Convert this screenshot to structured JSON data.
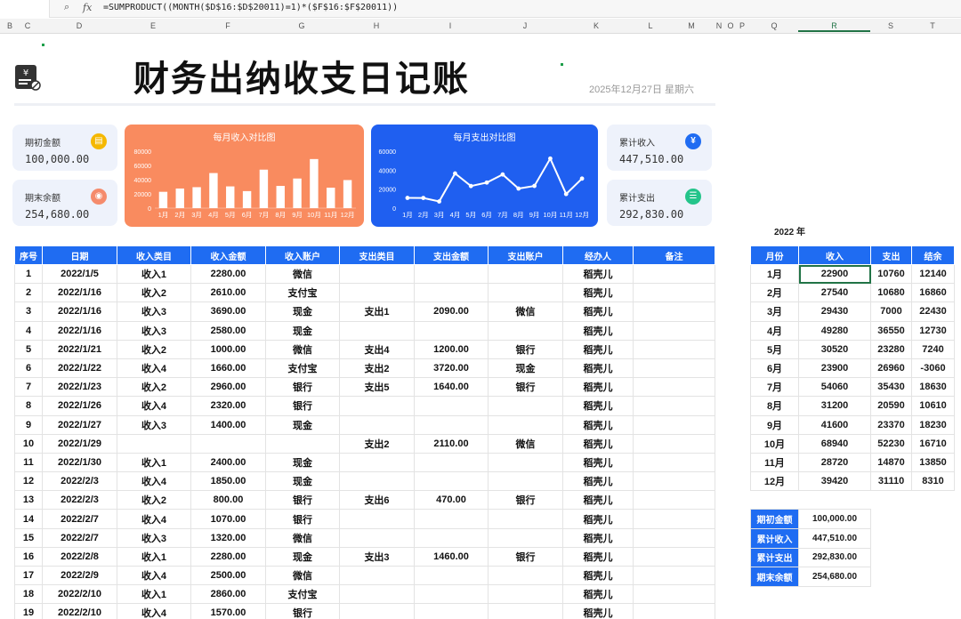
{
  "formula_bar": {
    "zoom_icon": "zoom-icon",
    "fx_label": "fx",
    "formula": "=SUMPRODUCT((MONTH($D$16:$D$20011)=1)*($F$16:$F$20011))"
  },
  "column_headers": [
    "B",
    "C",
    "D",
    "E",
    "F",
    "G",
    "H",
    "I",
    "J",
    "K",
    "L",
    "M",
    "N",
    "O",
    "P",
    "Q",
    "R",
    "S",
    "T"
  ],
  "title": "财务出纳收支日记账",
  "date": "2025年12月27日 星期六",
  "cards": {
    "opening": {
      "label": "期初金额",
      "value": "100,000.00",
      "icon": "wallet-icon",
      "color": "#f5b800"
    },
    "closing": {
      "label": "期末余额",
      "value": "254,680.00",
      "icon": "moneybag-icon",
      "color": "#f58b6c"
    },
    "total_income": {
      "label": "累计收入",
      "value": "447,510.00",
      "icon": "yen-icon",
      "color": "#1f6cf2"
    },
    "total_expense": {
      "label": "累计支出",
      "value": "292,830.00",
      "icon": "clipboard-icon",
      "color": "#24c48a"
    }
  },
  "chart_data": [
    {
      "type": "bar",
      "title": "每月收入对比图",
      "categories": [
        "1月",
        "2月",
        "3月",
        "4月",
        "5月",
        "6月",
        "7月",
        "8月",
        "9月",
        "10月",
        "11月",
        "12月"
      ],
      "values": [
        22900,
        27540,
        29430,
        49280,
        30520,
        23900,
        54060,
        31200,
        41600,
        68940,
        28720,
        39420
      ],
      "yticks": [
        "0",
        "20000",
        "40000",
        "60000",
        "80000"
      ],
      "ylim": [
        0,
        80000
      ],
      "colors": {
        "bg": "#f98b5f",
        "bar": "#ffffff",
        "text": "#ffffff"
      }
    },
    {
      "type": "line",
      "title": "每月支出对比图",
      "categories": [
        "1月",
        "2月",
        "3月",
        "4月",
        "5月",
        "6月",
        "7月",
        "8月",
        "9月",
        "10月",
        "11月",
        "12月"
      ],
      "values": [
        10760,
        10680,
        7000,
        36550,
        23280,
        26960,
        35430,
        20590,
        23370,
        52230,
        14870,
        31110
      ],
      "yticks": [
        "0",
        "20000",
        "40000",
        "60000"
      ],
      "ylim": [
        0,
        60000
      ],
      "colors": {
        "bg": "#1f5ff0",
        "line": "#ffffff",
        "text": "#ffffff"
      }
    }
  ],
  "main_table": {
    "headers": [
      "序号",
      "日期",
      "收入类目",
      "收入金额",
      "收入账户",
      "支出类目",
      "支出金额",
      "支出账户",
      "经办人",
      "备注"
    ],
    "rows": [
      [
        "1",
        "2022/1/5",
        "收入1",
        "2280.00",
        "微信",
        "",
        "",
        "",
        "稻壳儿",
        ""
      ],
      [
        "2",
        "2022/1/16",
        "收入2",
        "2610.00",
        "支付宝",
        "",
        "",
        "",
        "稻壳儿",
        ""
      ],
      [
        "3",
        "2022/1/16",
        "收入3",
        "3690.00",
        "现金",
        "支出1",
        "2090.00",
        "微信",
        "稻壳儿",
        ""
      ],
      [
        "4",
        "2022/1/16",
        "收入3",
        "2580.00",
        "现金",
        "",
        "",
        "",
        "稻壳儿",
        ""
      ],
      [
        "5",
        "2022/1/21",
        "收入2",
        "1000.00",
        "微信",
        "支出4",
        "1200.00",
        "银行",
        "稻壳儿",
        ""
      ],
      [
        "6",
        "2022/1/22",
        "收入4",
        "1660.00",
        "支付宝",
        "支出2",
        "3720.00",
        "现金",
        "稻壳儿",
        ""
      ],
      [
        "7",
        "2022/1/23",
        "收入2",
        "2960.00",
        "银行",
        "支出5",
        "1640.00",
        "银行",
        "稻壳儿",
        ""
      ],
      [
        "8",
        "2022/1/26",
        "收入4",
        "2320.00",
        "银行",
        "",
        "",
        "",
        "稻壳儿",
        ""
      ],
      [
        "9",
        "2022/1/27",
        "收入3",
        "1400.00",
        "现金",
        "",
        "",
        "",
        "稻壳儿",
        ""
      ],
      [
        "10",
        "2022/1/29",
        "",
        "",
        "",
        "支出2",
        "2110.00",
        "微信",
        "稻壳儿",
        ""
      ],
      [
        "11",
        "2022/1/30",
        "收入1",
        "2400.00",
        "现金",
        "",
        "",
        "",
        "稻壳儿",
        ""
      ],
      [
        "12",
        "2022/2/3",
        "收入4",
        "1850.00",
        "现金",
        "",
        "",
        "",
        "稻壳儿",
        ""
      ],
      [
        "13",
        "2022/2/3",
        "收入2",
        "800.00",
        "银行",
        "支出6",
        "470.00",
        "银行",
        "稻壳儿",
        ""
      ],
      [
        "14",
        "2022/2/7",
        "收入4",
        "1070.00",
        "银行",
        "",
        "",
        "",
        "稻壳儿",
        ""
      ],
      [
        "15",
        "2022/2/7",
        "收入3",
        "1320.00",
        "微信",
        "",
        "",
        "",
        "稻壳儿",
        ""
      ],
      [
        "16",
        "2022/2/8",
        "收入1",
        "2280.00",
        "现金",
        "支出3",
        "1460.00",
        "银行",
        "稻壳儿",
        ""
      ],
      [
        "17",
        "2022/2/9",
        "收入4",
        "2500.00",
        "微信",
        "",
        "",
        "",
        "稻壳儿",
        ""
      ],
      [
        "18",
        "2022/2/10",
        "收入1",
        "2860.00",
        "支付宝",
        "",
        "",
        "",
        "稻壳儿",
        ""
      ],
      [
        "19",
        "2022/2/10",
        "收入4",
        "1570.00",
        "银行",
        "",
        "",
        "",
        "稻壳儿",
        ""
      ]
    ]
  },
  "year_label": "2022 年",
  "monthly_table": {
    "headers": [
      "月份",
      "收入",
      "支出",
      "结余"
    ],
    "rows": [
      [
        "1月",
        "22900",
        "10760",
        "12140"
      ],
      [
        "2月",
        "27540",
        "10680",
        "16860"
      ],
      [
        "3月",
        "29430",
        "7000",
        "22430"
      ],
      [
        "4月",
        "49280",
        "36550",
        "12730"
      ],
      [
        "5月",
        "30520",
        "23280",
        "7240"
      ],
      [
        "6月",
        "23900",
        "26960",
        "-3060"
      ],
      [
        "7月",
        "54060",
        "35430",
        "18630"
      ],
      [
        "8月",
        "31200",
        "20590",
        "10610"
      ],
      [
        "9月",
        "41600",
        "23370",
        "18230"
      ],
      [
        "10月",
        "68940",
        "52230",
        "16710"
      ],
      [
        "11月",
        "28720",
        "14870",
        "13850"
      ],
      [
        "12月",
        "39420",
        "31110",
        "8310"
      ]
    ]
  },
  "summary_table": {
    "rows": [
      [
        "期初金额",
        "100,000.00"
      ],
      [
        "累计收入",
        "447,510.00"
      ],
      [
        "累计支出",
        "292,830.00"
      ],
      [
        "期末余额",
        "254,680.00"
      ]
    ]
  }
}
